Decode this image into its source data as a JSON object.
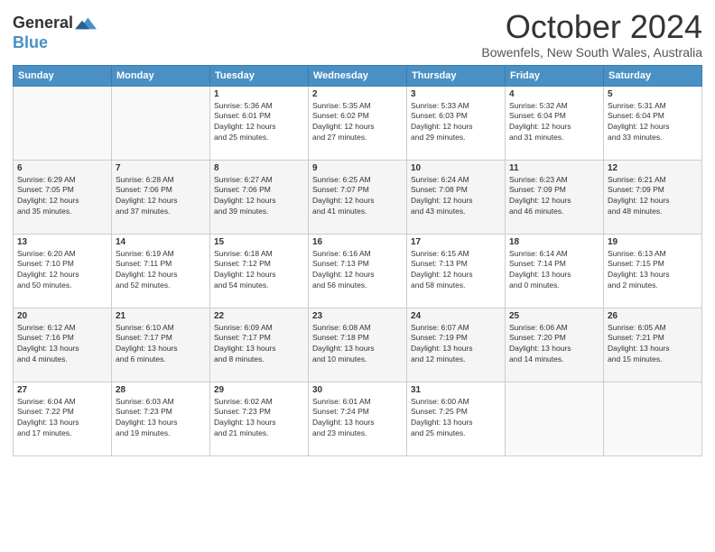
{
  "logo": {
    "line1": "General",
    "line2": "Blue"
  },
  "title": "October 2024",
  "location": "Bowenfels, New South Wales, Australia",
  "headers": [
    "Sunday",
    "Monday",
    "Tuesday",
    "Wednesday",
    "Thursday",
    "Friday",
    "Saturday"
  ],
  "weeks": [
    [
      {
        "day": "",
        "info": ""
      },
      {
        "day": "",
        "info": ""
      },
      {
        "day": "1",
        "info": "Sunrise: 5:36 AM\nSunset: 6:01 PM\nDaylight: 12 hours\nand 25 minutes."
      },
      {
        "day": "2",
        "info": "Sunrise: 5:35 AM\nSunset: 6:02 PM\nDaylight: 12 hours\nand 27 minutes."
      },
      {
        "day": "3",
        "info": "Sunrise: 5:33 AM\nSunset: 6:03 PM\nDaylight: 12 hours\nand 29 minutes."
      },
      {
        "day": "4",
        "info": "Sunrise: 5:32 AM\nSunset: 6:04 PM\nDaylight: 12 hours\nand 31 minutes."
      },
      {
        "day": "5",
        "info": "Sunrise: 5:31 AM\nSunset: 6:04 PM\nDaylight: 12 hours\nand 33 minutes."
      }
    ],
    [
      {
        "day": "6",
        "info": "Sunrise: 6:29 AM\nSunset: 7:05 PM\nDaylight: 12 hours\nand 35 minutes."
      },
      {
        "day": "7",
        "info": "Sunrise: 6:28 AM\nSunset: 7:06 PM\nDaylight: 12 hours\nand 37 minutes."
      },
      {
        "day": "8",
        "info": "Sunrise: 6:27 AM\nSunset: 7:06 PM\nDaylight: 12 hours\nand 39 minutes."
      },
      {
        "day": "9",
        "info": "Sunrise: 6:25 AM\nSunset: 7:07 PM\nDaylight: 12 hours\nand 41 minutes."
      },
      {
        "day": "10",
        "info": "Sunrise: 6:24 AM\nSunset: 7:08 PM\nDaylight: 12 hours\nand 43 minutes."
      },
      {
        "day": "11",
        "info": "Sunrise: 6:23 AM\nSunset: 7:09 PM\nDaylight: 12 hours\nand 46 minutes."
      },
      {
        "day": "12",
        "info": "Sunrise: 6:21 AM\nSunset: 7:09 PM\nDaylight: 12 hours\nand 48 minutes."
      }
    ],
    [
      {
        "day": "13",
        "info": "Sunrise: 6:20 AM\nSunset: 7:10 PM\nDaylight: 12 hours\nand 50 minutes."
      },
      {
        "day": "14",
        "info": "Sunrise: 6:19 AM\nSunset: 7:11 PM\nDaylight: 12 hours\nand 52 minutes."
      },
      {
        "day": "15",
        "info": "Sunrise: 6:18 AM\nSunset: 7:12 PM\nDaylight: 12 hours\nand 54 minutes."
      },
      {
        "day": "16",
        "info": "Sunrise: 6:16 AM\nSunset: 7:13 PM\nDaylight: 12 hours\nand 56 minutes."
      },
      {
        "day": "17",
        "info": "Sunrise: 6:15 AM\nSunset: 7:13 PM\nDaylight: 12 hours\nand 58 minutes."
      },
      {
        "day": "18",
        "info": "Sunrise: 6:14 AM\nSunset: 7:14 PM\nDaylight: 13 hours\nand 0 minutes."
      },
      {
        "day": "19",
        "info": "Sunrise: 6:13 AM\nSunset: 7:15 PM\nDaylight: 13 hours\nand 2 minutes."
      }
    ],
    [
      {
        "day": "20",
        "info": "Sunrise: 6:12 AM\nSunset: 7:16 PM\nDaylight: 13 hours\nand 4 minutes."
      },
      {
        "day": "21",
        "info": "Sunrise: 6:10 AM\nSunset: 7:17 PM\nDaylight: 13 hours\nand 6 minutes."
      },
      {
        "day": "22",
        "info": "Sunrise: 6:09 AM\nSunset: 7:17 PM\nDaylight: 13 hours\nand 8 minutes."
      },
      {
        "day": "23",
        "info": "Sunrise: 6:08 AM\nSunset: 7:18 PM\nDaylight: 13 hours\nand 10 minutes."
      },
      {
        "day": "24",
        "info": "Sunrise: 6:07 AM\nSunset: 7:19 PM\nDaylight: 13 hours\nand 12 minutes."
      },
      {
        "day": "25",
        "info": "Sunrise: 6:06 AM\nSunset: 7:20 PM\nDaylight: 13 hours\nand 14 minutes."
      },
      {
        "day": "26",
        "info": "Sunrise: 6:05 AM\nSunset: 7:21 PM\nDaylight: 13 hours\nand 15 minutes."
      }
    ],
    [
      {
        "day": "27",
        "info": "Sunrise: 6:04 AM\nSunset: 7:22 PM\nDaylight: 13 hours\nand 17 minutes."
      },
      {
        "day": "28",
        "info": "Sunrise: 6:03 AM\nSunset: 7:23 PM\nDaylight: 13 hours\nand 19 minutes."
      },
      {
        "day": "29",
        "info": "Sunrise: 6:02 AM\nSunset: 7:23 PM\nDaylight: 13 hours\nand 21 minutes."
      },
      {
        "day": "30",
        "info": "Sunrise: 6:01 AM\nSunset: 7:24 PM\nDaylight: 13 hours\nand 23 minutes."
      },
      {
        "day": "31",
        "info": "Sunrise: 6:00 AM\nSunset: 7:25 PM\nDaylight: 13 hours\nand 25 minutes."
      },
      {
        "day": "",
        "info": ""
      },
      {
        "day": "",
        "info": ""
      }
    ]
  ]
}
